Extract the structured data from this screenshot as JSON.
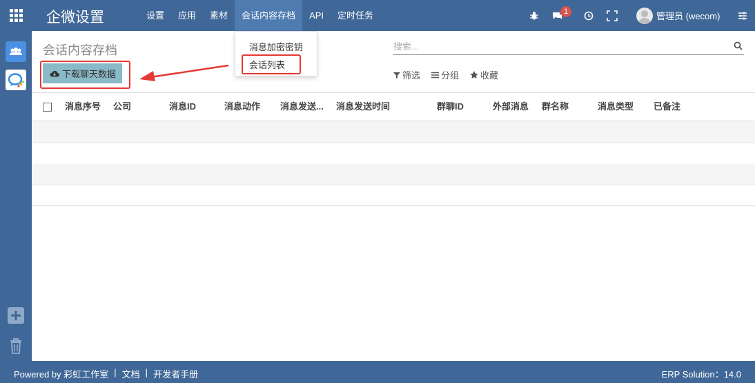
{
  "navbar": {
    "brand": "企微设置",
    "menu": [
      "设置",
      "应用",
      "素材",
      "会话内容存档",
      "API",
      "定时任务"
    ],
    "notification_count": "1",
    "user": "管理员 (wecom)"
  },
  "dropdown": {
    "items": [
      "消息加密密钥",
      "会话列表"
    ]
  },
  "main": {
    "title": "会话内容存档",
    "download_label": "下载聊天数据",
    "search_placeholder": "搜索...",
    "facets": [
      "筛选",
      "分组",
      "收藏"
    ],
    "columns": [
      "消息序号",
      "公司",
      "消息ID",
      "消息动作",
      "消息发送...",
      "消息发送时间",
      "群聊ID",
      "外部消息",
      "群名称",
      "消息类型",
      "已备注"
    ]
  },
  "footer": {
    "powered": "Powered by 彩虹工作室",
    "sep": "|",
    "doc": "文档",
    "dev": "开发者手册",
    "version": "ERP Solution：14.0"
  },
  "colors": {
    "nav_bg": "#3f6797",
    "active_menu": "#4e7bb0",
    "button_bg": "#8ab9c7",
    "highlight": "#e53935"
  }
}
